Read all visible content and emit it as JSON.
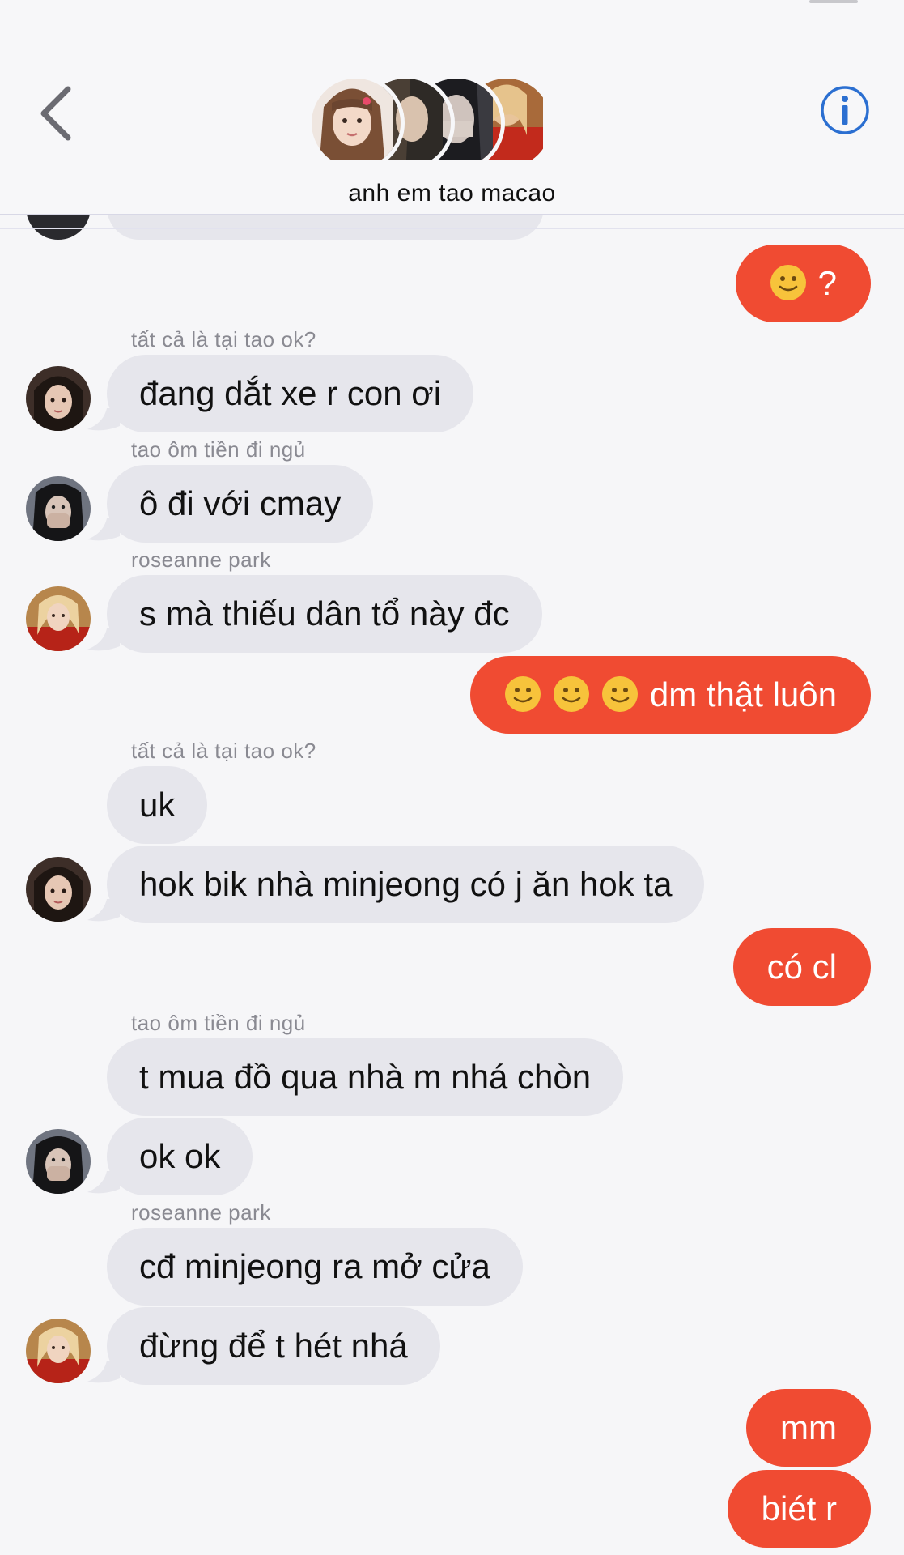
{
  "header": {
    "back_icon": "chevron-left-icon",
    "info_icon": "info-circle-icon",
    "group_name": "anh em tao macao",
    "accent_color": "#2b6fd1"
  },
  "colors": {
    "outgoing_bubble": "#f04b32",
    "incoming_bubble": "#e6e6ec",
    "background": "#f6f6f8"
  },
  "messages": [
    {
      "direction": "out",
      "emoji_count": 1,
      "text": "?"
    },
    {
      "sender": "tất cả là tại tao ok?",
      "direction": "in",
      "text": "đang dắt xe r con ơi"
    },
    {
      "sender": "tao ôm tiền đi ngủ",
      "direction": "in",
      "text": "ô đi với cmay"
    },
    {
      "sender": "roseanne park",
      "direction": "in",
      "text": "s mà thiếu dân tổ này đc"
    },
    {
      "direction": "out",
      "emoji_count": 3,
      "text": "dm thật luôn"
    },
    {
      "sender": "tất cả là tại tao ok?",
      "direction": "in",
      "text": "uk"
    },
    {
      "direction": "in",
      "text": "hok bik nhà minjeong có j ăn hok ta"
    },
    {
      "direction": "out",
      "text": "có cl"
    },
    {
      "sender": "tao ôm tiền đi ngủ",
      "direction": "in",
      "text": "t mua đồ qua nhà m nhá chòn"
    },
    {
      "direction": "in",
      "text": "ok ok"
    },
    {
      "sender": "roseanne park",
      "direction": "in",
      "text": "cđ minjeong ra mở cửa"
    },
    {
      "direction": "in",
      "text": "đừng để t hét nhá"
    },
    {
      "direction": "out",
      "text": "mm"
    },
    {
      "direction": "out",
      "text": "biét r"
    }
  ]
}
